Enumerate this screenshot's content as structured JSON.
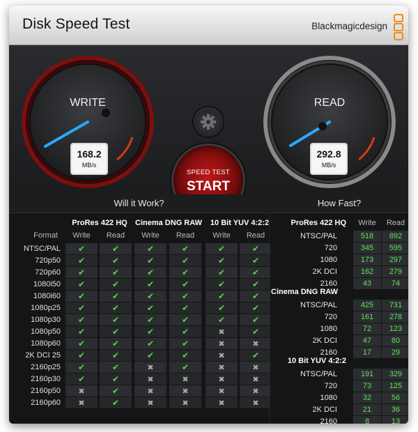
{
  "window": {
    "title": "Disk Speed Test",
    "brand": "Blackmagicdesign"
  },
  "gauges": {
    "write": {
      "label": "WRITE",
      "value": "168.2",
      "unit": "MB/s"
    },
    "read": {
      "label": "READ",
      "value": "292.8",
      "unit": "MB/s"
    }
  },
  "start_button": {
    "top_label": "SPEED TEST",
    "main_label": "START"
  },
  "will_it_work": {
    "title": "Will it Work?",
    "format_label": "Format",
    "write_label": "Write",
    "read_label": "Read",
    "codecs": [
      "ProRes 422 HQ",
      "Cinema DNG RAW",
      "10 Bit YUV 4:2:2"
    ],
    "rows": [
      {
        "format": "NTSC/PAL",
        "support": [
          1,
          1,
          1,
          1,
          1,
          1
        ]
      },
      {
        "format": "720p50",
        "support": [
          1,
          1,
          1,
          1,
          1,
          1
        ]
      },
      {
        "format": "720p60",
        "support": [
          1,
          1,
          1,
          1,
          1,
          1
        ]
      },
      {
        "format": "1080i50",
        "support": [
          1,
          1,
          1,
          1,
          1,
          1
        ]
      },
      {
        "format": "1080i60",
        "support": [
          1,
          1,
          1,
          1,
          1,
          1
        ]
      },
      {
        "format": "1080p25",
        "support": [
          1,
          1,
          1,
          1,
          1,
          1
        ]
      },
      {
        "format": "1080p30",
        "support": [
          1,
          1,
          1,
          1,
          1,
          1
        ]
      },
      {
        "format": "1080p50",
        "support": [
          1,
          1,
          1,
          1,
          0,
          1
        ]
      },
      {
        "format": "1080p60",
        "support": [
          1,
          1,
          1,
          1,
          0,
          0
        ]
      },
      {
        "format": "2K DCI 25",
        "support": [
          1,
          1,
          1,
          1,
          0,
          1
        ]
      },
      {
        "format": "2160p25",
        "support": [
          1,
          1,
          0,
          1,
          0,
          0
        ]
      },
      {
        "format": "2160p30",
        "support": [
          1,
          1,
          0,
          0,
          0,
          0
        ]
      },
      {
        "format": "2160p50",
        "support": [
          0,
          1,
          0,
          0,
          0,
          0
        ]
      },
      {
        "format": "2160p60",
        "support": [
          0,
          1,
          0,
          0,
          0,
          0
        ]
      }
    ]
  },
  "how_fast": {
    "title": "How Fast?",
    "write_label": "Write",
    "read_label": "Read",
    "groups": [
      {
        "name": "ProRes 422 HQ",
        "rows": [
          {
            "format": "NTSC/PAL",
            "write": "518",
            "read": "892"
          },
          {
            "format": "720",
            "write": "345",
            "read": "595"
          },
          {
            "format": "1080",
            "write": "173",
            "read": "297"
          },
          {
            "format": "2K DCI",
            "write": "162",
            "read": "279"
          },
          {
            "format": "2160",
            "write": "43",
            "read": "74"
          }
        ]
      },
      {
        "name": "Cinema DNG RAW",
        "rows": [
          {
            "format": "NTSC/PAL",
            "write": "425",
            "read": "731"
          },
          {
            "format": "720",
            "write": "161",
            "read": "278"
          },
          {
            "format": "1080",
            "write": "72",
            "read": "123"
          },
          {
            "format": "2K DCI",
            "write": "47",
            "read": "80"
          },
          {
            "format": "2160",
            "write": "17",
            "read": "29"
          }
        ]
      },
      {
        "name": "10 Bit YUV 4:2:2",
        "rows": [
          {
            "format": "NTSC/PAL",
            "write": "191",
            "read": "329"
          },
          {
            "format": "720",
            "write": "73",
            "read": "125"
          },
          {
            "format": "1080",
            "write": "32",
            "read": "56"
          },
          {
            "format": "2K DCI",
            "write": "21",
            "read": "36"
          },
          {
            "format": "2160",
            "write": "8",
            "read": "13"
          }
        ]
      }
    ]
  },
  "colors": {
    "accent_green": "#56d84a",
    "needle_blue": "#29a9ff",
    "start_red": "#c01818",
    "brand_orange": "#f28a10"
  },
  "icons": {
    "settings": "gear-icon",
    "yes": "check-icon",
    "no": "cross-icon"
  }
}
